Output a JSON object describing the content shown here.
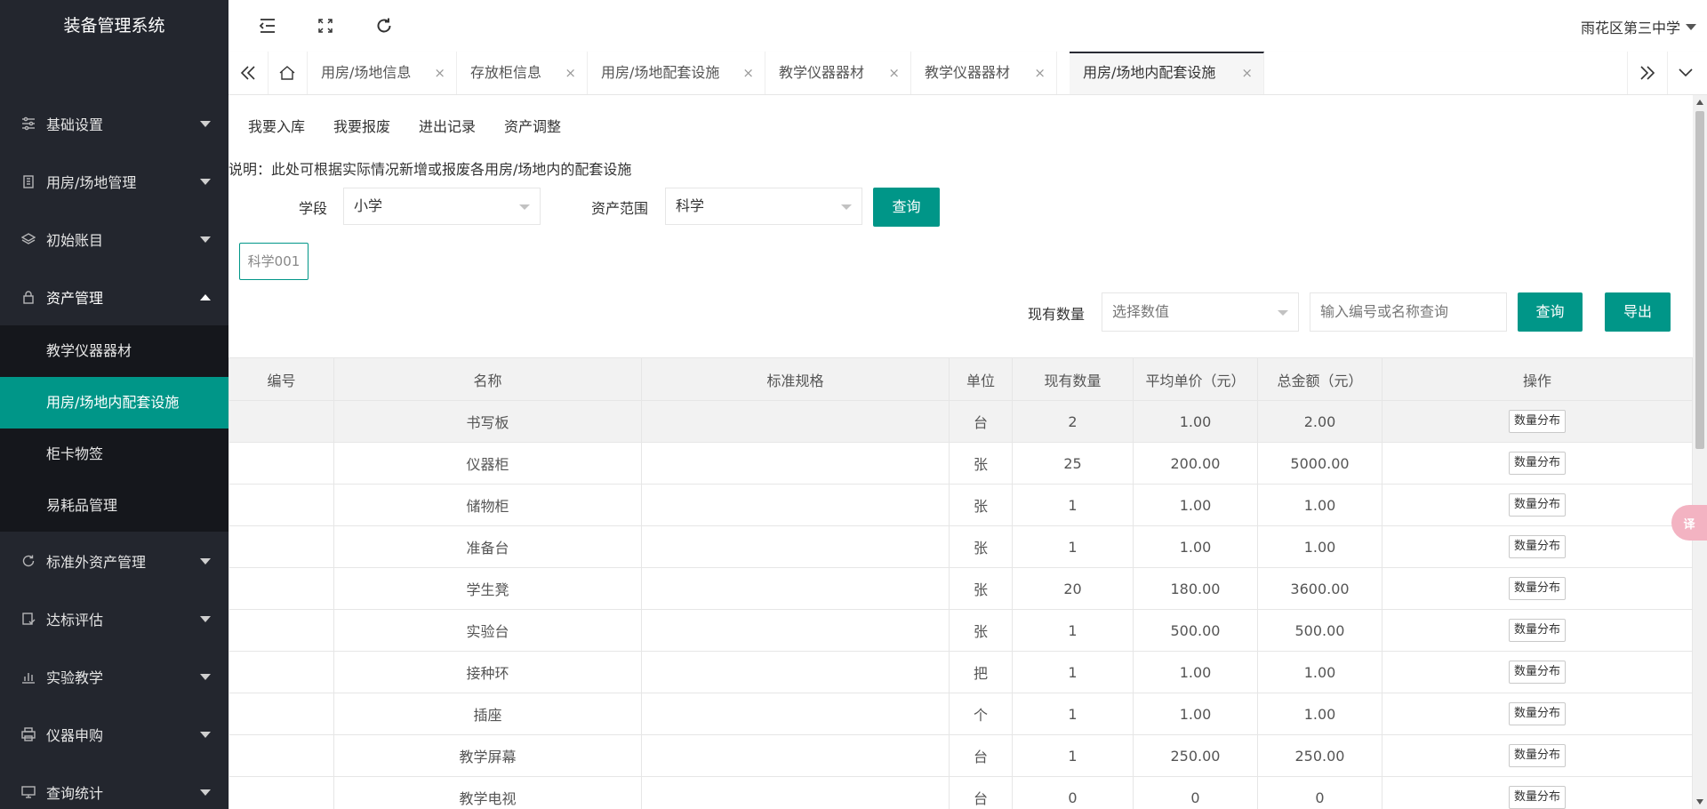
{
  "app": {
    "title": "装备管理系统",
    "user": "雨花区第三中学"
  },
  "sidebar": {
    "items": [
      {
        "label": "基础设置",
        "icon": "sliders-icon",
        "expanded": false
      },
      {
        "label": "用房/场地管理",
        "icon": "building-icon",
        "expanded": false
      },
      {
        "label": "初始账目",
        "icon": "layers-icon",
        "expanded": false
      },
      {
        "label": "资产管理",
        "icon": "lock-icon",
        "expanded": true,
        "children": [
          {
            "label": "教学仪器器材",
            "active": false
          },
          {
            "label": "用房/场地内配套设施",
            "active": true
          },
          {
            "label": "柜卡物签",
            "active": false
          },
          {
            "label": "易耗品管理",
            "active": false
          }
        ]
      },
      {
        "label": "标准外资产管理",
        "icon": "refresh-circle-icon",
        "expanded": false
      },
      {
        "label": "达标评估",
        "icon": "checklist-icon",
        "expanded": false
      },
      {
        "label": "实验教学",
        "icon": "bar-chart-icon",
        "expanded": false
      },
      {
        "label": "仪器申购",
        "icon": "printer-icon",
        "expanded": false
      },
      {
        "label": "查询统计",
        "icon": "monitor-icon",
        "expanded": false
      }
    ]
  },
  "tabs": [
    {
      "label": "用房/场地信息",
      "active": false
    },
    {
      "label": "存放柜信息",
      "active": false
    },
    {
      "label": "用房/场地配套设施",
      "active": false
    },
    {
      "label": "教学仪器器材",
      "active": false
    },
    {
      "label": "教学仪器器材",
      "active": false
    },
    {
      "label": "用房/场地内配套设施",
      "active": true
    }
  ],
  "toolbar": {
    "links": [
      "我要入库",
      "我要报废",
      "进出记录",
      "资产调整"
    ]
  },
  "description": "说明：此处可根据实际情况新增或报废各用房/场地内的配套设施",
  "filters": {
    "stage_label": "学段",
    "stage_value": "小学",
    "scope_label": "资产范围",
    "scope_value": "科学",
    "query_label": "查询"
  },
  "chip": "科学001",
  "search": {
    "qty_label": "现有数量",
    "qty_placeholder": "选择数值",
    "keyword_placeholder": "输入编号或名称查询",
    "query_label": "查询",
    "export_label": "导出"
  },
  "table": {
    "headers": [
      "编号",
      "名称",
      "标准规格",
      "单位",
      "现有数量",
      "平均单价（元）",
      "总金额（元）",
      "操作"
    ],
    "action_label": "数量分布",
    "rows": [
      [
        "",
        "书写板",
        "",
        "台",
        "2",
        "1.00",
        "2.00"
      ],
      [
        "",
        "仪器柜",
        "",
        "张",
        "25",
        "200.00",
        "5000.00"
      ],
      [
        "",
        "储物柜",
        "",
        "张",
        "1",
        "1.00",
        "1.00"
      ],
      [
        "",
        "准备台",
        "",
        "张",
        "1",
        "1.00",
        "1.00"
      ],
      [
        "",
        "学生凳",
        "",
        "张",
        "20",
        "180.00",
        "3600.00"
      ],
      [
        "",
        "实验台",
        "",
        "张",
        "1",
        "500.00",
        "500.00"
      ],
      [
        "",
        "接种环",
        "",
        "把",
        "1",
        "1.00",
        "1.00"
      ],
      [
        "",
        "插座",
        "",
        "个",
        "1",
        "1.00",
        "1.00"
      ],
      [
        "",
        "教学屏幕",
        "",
        "台",
        "1",
        "250.00",
        "250.00"
      ],
      [
        "",
        "教学电视",
        "",
        "台",
        "0",
        "0",
        "0"
      ]
    ]
  },
  "floating": {
    "label": "译"
  },
  "colors": {
    "sidebar": "#23262e",
    "accent": "#009688"
  }
}
